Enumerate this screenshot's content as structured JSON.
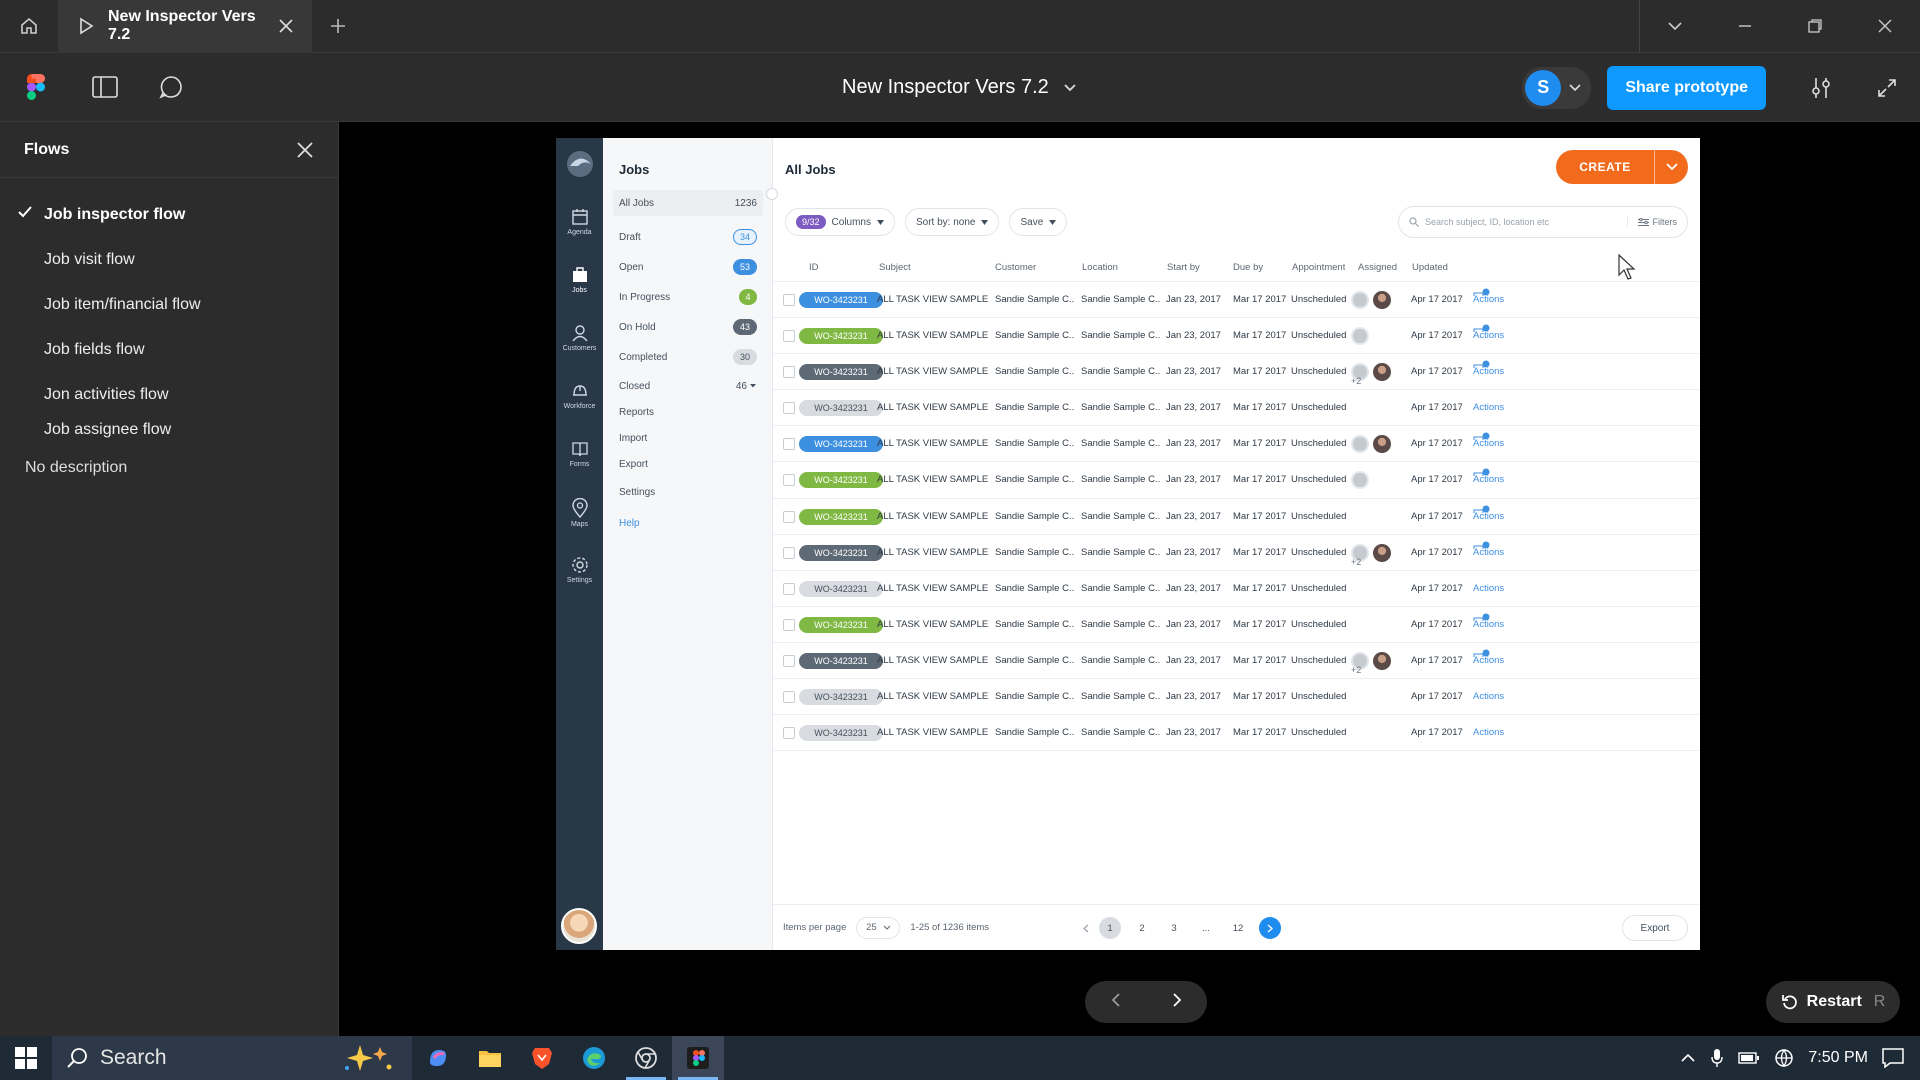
{
  "browser": {
    "tab_title": "New Inspector Vers 7.2"
  },
  "figma": {
    "doc_title": "New Inspector Vers 7.2",
    "user_initial": "S",
    "share_label": "Share prototype"
  },
  "flows": {
    "title": "Flows",
    "items": [
      {
        "label": "Job inspector flow"
      },
      {
        "label": "Job visit flow"
      },
      {
        "label": "Job item/financial flow"
      },
      {
        "label": "Job fields flow"
      },
      {
        "label": "Jon activities flow"
      },
      {
        "label": "Job assignee flow"
      }
    ],
    "description": "No description"
  },
  "app": {
    "rail": [
      {
        "label": "Agenda",
        "icon": "calendar-icon"
      },
      {
        "label": "Jobs",
        "icon": "briefcase-icon"
      },
      {
        "label": "Customers",
        "icon": "users-icon"
      },
      {
        "label": "Workforce",
        "icon": "hardhat-icon"
      },
      {
        "label": "Forms",
        "icon": "book-icon"
      },
      {
        "label": "Maps",
        "icon": "pin-icon"
      },
      {
        "label": "Settings",
        "icon": "gear-icon"
      }
    ],
    "submenu": {
      "title": "Jobs",
      "items": [
        {
          "label": "All Jobs",
          "count": "1236"
        },
        {
          "label": "Draft",
          "count": "34",
          "color": "#e6f3fc"
        },
        {
          "label": "Open",
          "count": "53",
          "color": "#3d8fe0"
        },
        {
          "label": "In Progress",
          "count": "4",
          "color": "#7fb842"
        },
        {
          "label": "On Hold",
          "count": "43",
          "color": "#5d6975"
        },
        {
          "label": "Completed",
          "count": "30",
          "color": "#d8dce1"
        },
        {
          "label": "Closed",
          "count": "46"
        },
        {
          "label": "Reports"
        },
        {
          "label": "Import"
        },
        {
          "label": "Export"
        },
        {
          "label": "Settings"
        },
        {
          "label": "Help"
        }
      ]
    },
    "main": {
      "title": "All Jobs",
      "create_label": "CREATE",
      "columns_count": "9/32",
      "columns_label": "Columns",
      "sort_label": "Sort by: none",
      "save_label": "Save",
      "search_placeholder": "Search subject, ID, location etc",
      "filters_label": "Filters",
      "headers": [
        "ID",
        "Subject",
        "Customer",
        "Location",
        "Start by",
        "Due by",
        "Appointment",
        "Assigned",
        "Updated"
      ],
      "rows": [
        {
          "id": "WO-3423231",
          "status_color": "#3d8fe0",
          "subject": "ALL TASK VIEW SAMPLE",
          "customer": "Sandie Sample C...",
          "location": "Sandie Sample C...",
          "start": "Jan 23, 2017",
          "due": "Mar 17 2017",
          "appointment": "Unscheduled",
          "assigned": "grey-photo",
          "updated": "Apr 17 2017",
          "notif": true,
          "action": "Actions"
        },
        {
          "id": "WO-3423231",
          "status_color": "#7fb842",
          "subject": "ALL TASK VIEW SAMPLE",
          "customer": "Sandie Sample C...",
          "location": "Sandie Sample C...",
          "start": "Jan 23, 2017",
          "due": "Mar 17 2017",
          "appointment": "Unscheduled",
          "assigned": "grey",
          "updated": "Apr 17 2017",
          "notif": true,
          "action": "Actions"
        },
        {
          "id": "WO-3423231",
          "status_color": "#5d6975",
          "subject": "ALL TASK VIEW SAMPLE",
          "customer": "Sandie Sample C...",
          "location": "Sandie Sample C...",
          "start": "Jan 23, 2017",
          "due": "Mar 17 2017",
          "appointment": "Unscheduled",
          "assigned": "grey-photo-plus",
          "updated": "Apr 17 2017",
          "notif": true,
          "action": "Actions"
        },
        {
          "id": "WO-3423231",
          "status_color": "#d8dce1",
          "subject": "ALL TASK VIEW SAMPLE",
          "customer": "Sandie Sample C...",
          "location": "Sandie Sample C...",
          "start": "Jan 23, 2017",
          "due": "Mar 17 2017",
          "appointment": "Unscheduled",
          "assigned": "none",
          "updated": "Apr 17 2017",
          "notif": false,
          "action": "Actions"
        },
        {
          "id": "WO-3423231",
          "status_color": "#3d8fe0",
          "subject": "ALL TASK VIEW SAMPLE",
          "customer": "Sandie Sample C...",
          "location": "Sandie Sample C...",
          "start": "Jan 23, 2017",
          "due": "Mar 17 2017",
          "appointment": "Unscheduled",
          "assigned": "grey-photo",
          "updated": "Apr 17 2017",
          "notif": true,
          "action": "Actions"
        },
        {
          "id": "WO-3423231",
          "status_color": "#7fb842",
          "subject": "ALL TASK VIEW SAMPLE",
          "customer": "Sandie Sample C...",
          "location": "Sandie Sample C...",
          "start": "Jan 23, 2017",
          "due": "Mar 17 2017",
          "appointment": "Unscheduled",
          "assigned": "grey",
          "updated": "Apr 17 2017",
          "notif": true,
          "action": "Actions"
        },
        {
          "id": "WO-3423231",
          "status_color": "#7fb842",
          "subject": "ALL TASK VIEW SAMPLE",
          "customer": "Sandie Sample C...",
          "location": "Sandie Sample C...",
          "start": "Jan 23, 2017",
          "due": "Mar 17 2017",
          "appointment": "Unscheduled",
          "assigned": "none",
          "updated": "Apr 17 2017",
          "notif": true,
          "action": "Actions"
        },
        {
          "id": "WO-3423231",
          "status_color": "#5d6975",
          "subject": "ALL TASK VIEW SAMPLE",
          "customer": "Sandie Sample C...",
          "location": "Sandie Sample C...",
          "start": "Jan 23, 2017",
          "due": "Mar 17 2017",
          "appointment": "Unscheduled",
          "assigned": "grey-photo-plus",
          "updated": "Apr 17 2017",
          "notif": true,
          "action": "Actions"
        },
        {
          "id": "WO-3423231",
          "status_color": "#d8dce1",
          "subject": "ALL TASK VIEW SAMPLE",
          "customer": "Sandie Sample C...",
          "location": "Sandie Sample C...",
          "start": "Jan 23, 2017",
          "due": "Mar 17 2017",
          "appointment": "Unscheduled",
          "assigned": "none",
          "updated": "Apr 17 2017",
          "notif": false,
          "action": "Actions"
        },
        {
          "id": "WO-3423231",
          "status_color": "#7fb842",
          "subject": "ALL TASK VIEW SAMPLE",
          "customer": "Sandie Sample C...",
          "location": "Sandie Sample C...",
          "start": "Jan 23, 2017",
          "due": "Mar 17 2017",
          "appointment": "Unscheduled",
          "assigned": "none",
          "updated": "Apr 17 2017",
          "notif": true,
          "action": "Actions"
        },
        {
          "id": "WO-3423231",
          "status_color": "#5d6975",
          "subject": "ALL TASK VIEW SAMPLE",
          "customer": "Sandie Sample C...",
          "location": "Sandie Sample C...",
          "start": "Jan 23, 2017",
          "due": "Mar 17 2017",
          "appointment": "Unscheduled",
          "assigned": "grey-photo-plus",
          "updated": "Apr 17 2017",
          "notif": true,
          "action": "Actions"
        },
        {
          "id": "WO-3423231",
          "status_color": "#d8dce1",
          "subject": "ALL TASK VIEW SAMPLE",
          "customer": "Sandie Sample C...",
          "location": "Sandie Sample C...",
          "start": "Jan 23, 2017",
          "due": "Mar 17 2017",
          "appointment": "Unscheduled",
          "assigned": "none",
          "updated": "Apr 17 2017",
          "notif": false,
          "action": "Actions"
        },
        {
          "id": "WO-3423231",
          "status_color": "#d8dce1",
          "subject": "ALL TASK VIEW SAMPLE",
          "customer": "Sandie Sample C...",
          "location": "Sandie Sample C...",
          "start": "Jan 23, 2017",
          "due": "Mar 17 2017",
          "appointment": "Unscheduled",
          "assigned": "none",
          "updated": "Apr 17 2017",
          "notif": false,
          "action": "Actions"
        }
      ],
      "plus_more": "+2",
      "footer": {
        "items_per_page_label": "Items per page",
        "items_per_page": "25",
        "range": "1-25 of 1236 items",
        "pages": [
          "1",
          "2",
          "3",
          "...",
          "12"
        ],
        "export_label": "Export"
      }
    }
  },
  "prototype": {
    "restart_label": "Restart",
    "restart_key": "R"
  },
  "taskbar": {
    "search_label": "Search",
    "time": "7:50 PM"
  },
  "colors": {
    "figma_blue": "#0d99ff",
    "create_orange": "#f26b1d",
    "rail_navy": "#293847",
    "link_blue": "#3d8fe0"
  }
}
